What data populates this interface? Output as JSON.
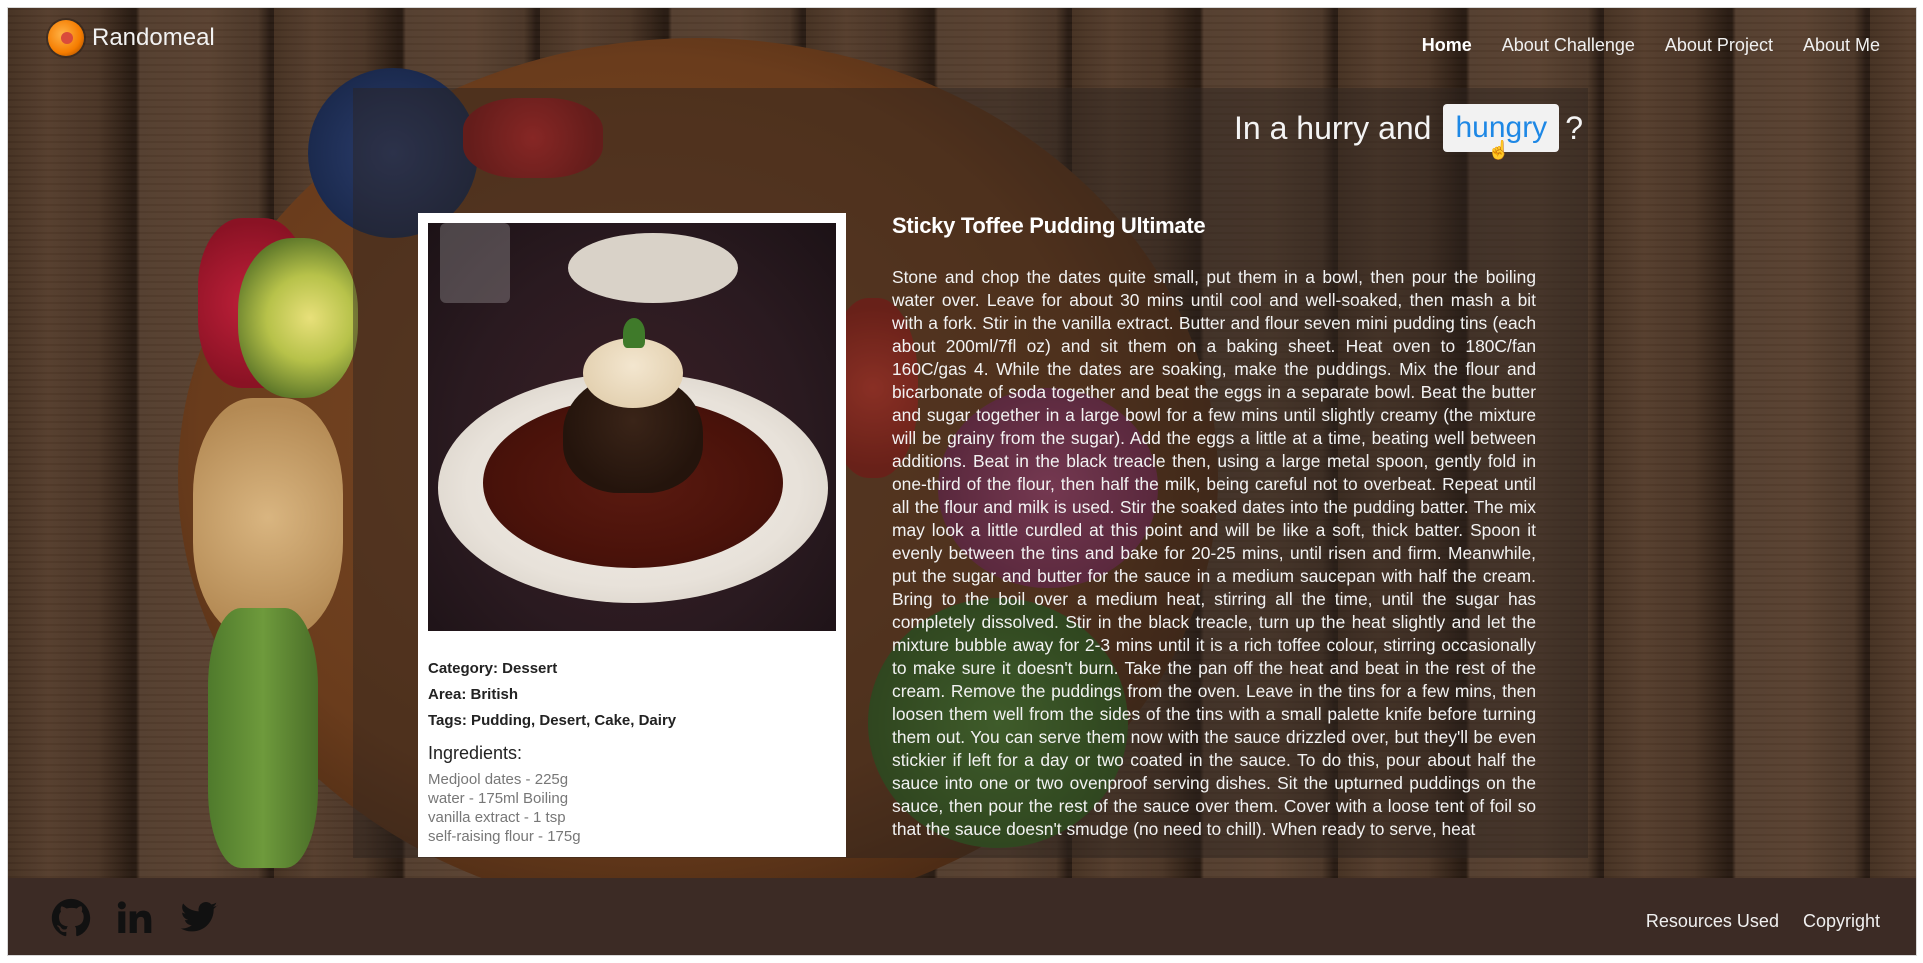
{
  "brand": {
    "name": "Randomeal",
    "logo_icon": "food-plate-logo"
  },
  "nav": {
    "items": [
      {
        "label": "Home",
        "active": true
      },
      {
        "label": "About Challenge",
        "active": false
      },
      {
        "label": "About Project",
        "active": false
      },
      {
        "label": "About Me",
        "active": false
      }
    ]
  },
  "headline": {
    "lead": "In a hurry and",
    "button_label": "hungry",
    "suffix": "?"
  },
  "recipe": {
    "title": "Sticky Toffee Pudding Ultimate",
    "category": "Category: Dessert",
    "area": "Area: British",
    "tags": "Tags: Pudding, Desert, Cake, Dairy",
    "ingredients_title": "Ingredients:",
    "ingredients": [
      "Medjool dates - 225g",
      "water - 175ml Boiling",
      "vanilla extract - 1 tsp",
      "self-raising flour - 175g"
    ],
    "instructions": "Stone and chop the dates quite small, put them in a bowl, then pour the boiling water over. Leave for about 30 mins until cool and well-soaked, then mash a bit with a fork. Stir in the vanilla extract. Butter and flour seven mini pudding tins (each about 200ml/7fl oz) and sit them on a baking sheet. Heat oven to 180C/fan 160C/gas 4. While the dates are soaking, make the puddings. Mix the flour and bicarbonate of soda together and beat the eggs in a separate bowl. Beat the butter and sugar together in a large bowl for a few mins until slightly creamy (the mixture will be grainy from the sugar). Add the eggs a little at a time, beating well between additions. Beat in the black treacle then, using a large metal spoon, gently fold in one-third of the flour, then half the milk, being careful not to overbeat. Repeat until all the flour and milk is used. Stir the soaked dates into the pudding batter. The mix may look a little curdled at this point and will be like a soft, thick batter. Spoon it evenly between the tins and bake for 20-25 mins, until risen and firm. Meanwhile, put the sugar and butter for the sauce in a medium saucepan with half the cream. Bring to the boil over a medium heat, stirring all the time, until the sugar has completely dissolved. Stir in the black treacle, turn up the heat slightly and let the mixture bubble away for 2-3 mins until it is a rich toffee colour, stirring occasionally to make sure it doesn't burn. Take the pan off the heat and beat in the rest of the cream. Remove the puddings from the oven. Leave in the tins for a few mins, then loosen them well from the sides of the tins with a small palette knife before turning them out. You can serve them now with the sauce drizzled over, but they'll be even stickier if left for a day or two coated in the sauce. To do this, pour about half the sauce into one or two ovenproof serving dishes. Sit the upturned puddings on the sauce, then pour the rest of the sauce over them. Cover with a loose tent of foil so that the sauce doesn't smudge (no need to chill). When ready to serve, heat"
  },
  "footer": {
    "social": [
      {
        "icon": "github-icon"
      },
      {
        "icon": "linkedin-icon"
      },
      {
        "icon": "twitter-icon"
      }
    ],
    "links": [
      "Resources Used",
      "Copyright"
    ]
  },
  "colors": {
    "accent": "#1e88e5",
    "footer_bg": "#3c2b25",
    "nav_text": "#f0f0f0"
  }
}
